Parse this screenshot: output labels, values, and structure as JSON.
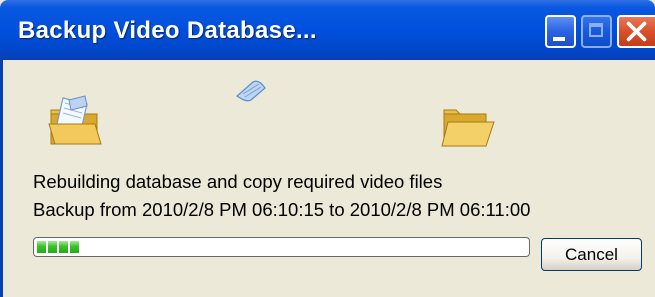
{
  "window": {
    "title": "Backup Video Database...",
    "title_bar_color": "#0050dd",
    "controls": {
      "minimize_icon": "minimize-icon",
      "maximize_icon": "maximize-icon",
      "close_icon": "close-icon"
    }
  },
  "animation": {
    "source_icon": "source-folder-icon",
    "flying_icon": "flying-paper-icon",
    "destination_icon": "destination-folder-icon"
  },
  "status": {
    "line1": "Rebuilding database and copy required video files",
    "line2": "Backup from 2010/2/8 PM 06:10:15 to 2010/2/8 PM 06:11:00"
  },
  "progress": {
    "fraction": 0.12,
    "segments_filled": 4,
    "fill_color": "#38c22a"
  },
  "buttons": {
    "cancel_label": "Cancel"
  }
}
